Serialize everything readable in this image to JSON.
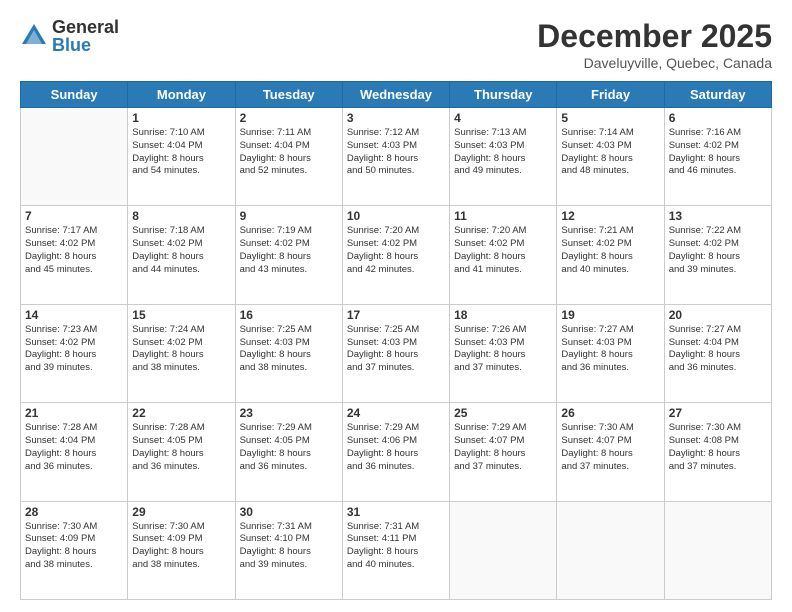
{
  "logo": {
    "general": "General",
    "blue": "Blue"
  },
  "header": {
    "month": "December 2025",
    "location": "Daveluyville, Quebec, Canada"
  },
  "weekdays": [
    "Sunday",
    "Monday",
    "Tuesday",
    "Wednesday",
    "Thursday",
    "Friday",
    "Saturday"
  ],
  "days": [
    {
      "date": "",
      "info": ""
    },
    {
      "date": "1",
      "info": "Sunrise: 7:10 AM\nSunset: 4:04 PM\nDaylight: 8 hours\nand 54 minutes."
    },
    {
      "date": "2",
      "info": "Sunrise: 7:11 AM\nSunset: 4:04 PM\nDaylight: 8 hours\nand 52 minutes."
    },
    {
      "date": "3",
      "info": "Sunrise: 7:12 AM\nSunset: 4:03 PM\nDaylight: 8 hours\nand 50 minutes."
    },
    {
      "date": "4",
      "info": "Sunrise: 7:13 AM\nSunset: 4:03 PM\nDaylight: 8 hours\nand 49 minutes."
    },
    {
      "date": "5",
      "info": "Sunrise: 7:14 AM\nSunset: 4:03 PM\nDaylight: 8 hours\nand 48 minutes."
    },
    {
      "date": "6",
      "info": "Sunrise: 7:16 AM\nSunset: 4:02 PM\nDaylight: 8 hours\nand 46 minutes."
    },
    {
      "date": "7",
      "info": "Sunrise: 7:17 AM\nSunset: 4:02 PM\nDaylight: 8 hours\nand 45 minutes."
    },
    {
      "date": "8",
      "info": "Sunrise: 7:18 AM\nSunset: 4:02 PM\nDaylight: 8 hours\nand 44 minutes."
    },
    {
      "date": "9",
      "info": "Sunrise: 7:19 AM\nSunset: 4:02 PM\nDaylight: 8 hours\nand 43 minutes."
    },
    {
      "date": "10",
      "info": "Sunrise: 7:20 AM\nSunset: 4:02 PM\nDaylight: 8 hours\nand 42 minutes."
    },
    {
      "date": "11",
      "info": "Sunrise: 7:20 AM\nSunset: 4:02 PM\nDaylight: 8 hours\nand 41 minutes."
    },
    {
      "date": "12",
      "info": "Sunrise: 7:21 AM\nSunset: 4:02 PM\nDaylight: 8 hours\nand 40 minutes."
    },
    {
      "date": "13",
      "info": "Sunrise: 7:22 AM\nSunset: 4:02 PM\nDaylight: 8 hours\nand 39 minutes."
    },
    {
      "date": "14",
      "info": "Sunrise: 7:23 AM\nSunset: 4:02 PM\nDaylight: 8 hours\nand 39 minutes."
    },
    {
      "date": "15",
      "info": "Sunrise: 7:24 AM\nSunset: 4:02 PM\nDaylight: 8 hours\nand 38 minutes."
    },
    {
      "date": "16",
      "info": "Sunrise: 7:25 AM\nSunset: 4:03 PM\nDaylight: 8 hours\nand 38 minutes."
    },
    {
      "date": "17",
      "info": "Sunrise: 7:25 AM\nSunset: 4:03 PM\nDaylight: 8 hours\nand 37 minutes."
    },
    {
      "date": "18",
      "info": "Sunrise: 7:26 AM\nSunset: 4:03 PM\nDaylight: 8 hours\nand 37 minutes."
    },
    {
      "date": "19",
      "info": "Sunrise: 7:27 AM\nSunset: 4:03 PM\nDaylight: 8 hours\nand 36 minutes."
    },
    {
      "date": "20",
      "info": "Sunrise: 7:27 AM\nSunset: 4:04 PM\nDaylight: 8 hours\nand 36 minutes."
    },
    {
      "date": "21",
      "info": "Sunrise: 7:28 AM\nSunset: 4:04 PM\nDaylight: 8 hours\nand 36 minutes."
    },
    {
      "date": "22",
      "info": "Sunrise: 7:28 AM\nSunset: 4:05 PM\nDaylight: 8 hours\nand 36 minutes."
    },
    {
      "date": "23",
      "info": "Sunrise: 7:29 AM\nSunset: 4:05 PM\nDaylight: 8 hours\nand 36 minutes."
    },
    {
      "date": "24",
      "info": "Sunrise: 7:29 AM\nSunset: 4:06 PM\nDaylight: 8 hours\nand 36 minutes."
    },
    {
      "date": "25",
      "info": "Sunrise: 7:29 AM\nSunset: 4:07 PM\nDaylight: 8 hours\nand 37 minutes."
    },
    {
      "date": "26",
      "info": "Sunrise: 7:30 AM\nSunset: 4:07 PM\nDaylight: 8 hours\nand 37 minutes."
    },
    {
      "date": "27",
      "info": "Sunrise: 7:30 AM\nSunset: 4:08 PM\nDaylight: 8 hours\nand 37 minutes."
    },
    {
      "date": "28",
      "info": "Sunrise: 7:30 AM\nSunset: 4:09 PM\nDaylight: 8 hours\nand 38 minutes."
    },
    {
      "date": "29",
      "info": "Sunrise: 7:30 AM\nSunset: 4:09 PM\nDaylight: 8 hours\nand 38 minutes."
    },
    {
      "date": "30",
      "info": "Sunrise: 7:31 AM\nSunset: 4:10 PM\nDaylight: 8 hours\nand 39 minutes."
    },
    {
      "date": "31",
      "info": "Sunrise: 7:31 AM\nSunset: 4:11 PM\nDaylight: 8 hours\nand 40 minutes."
    }
  ]
}
